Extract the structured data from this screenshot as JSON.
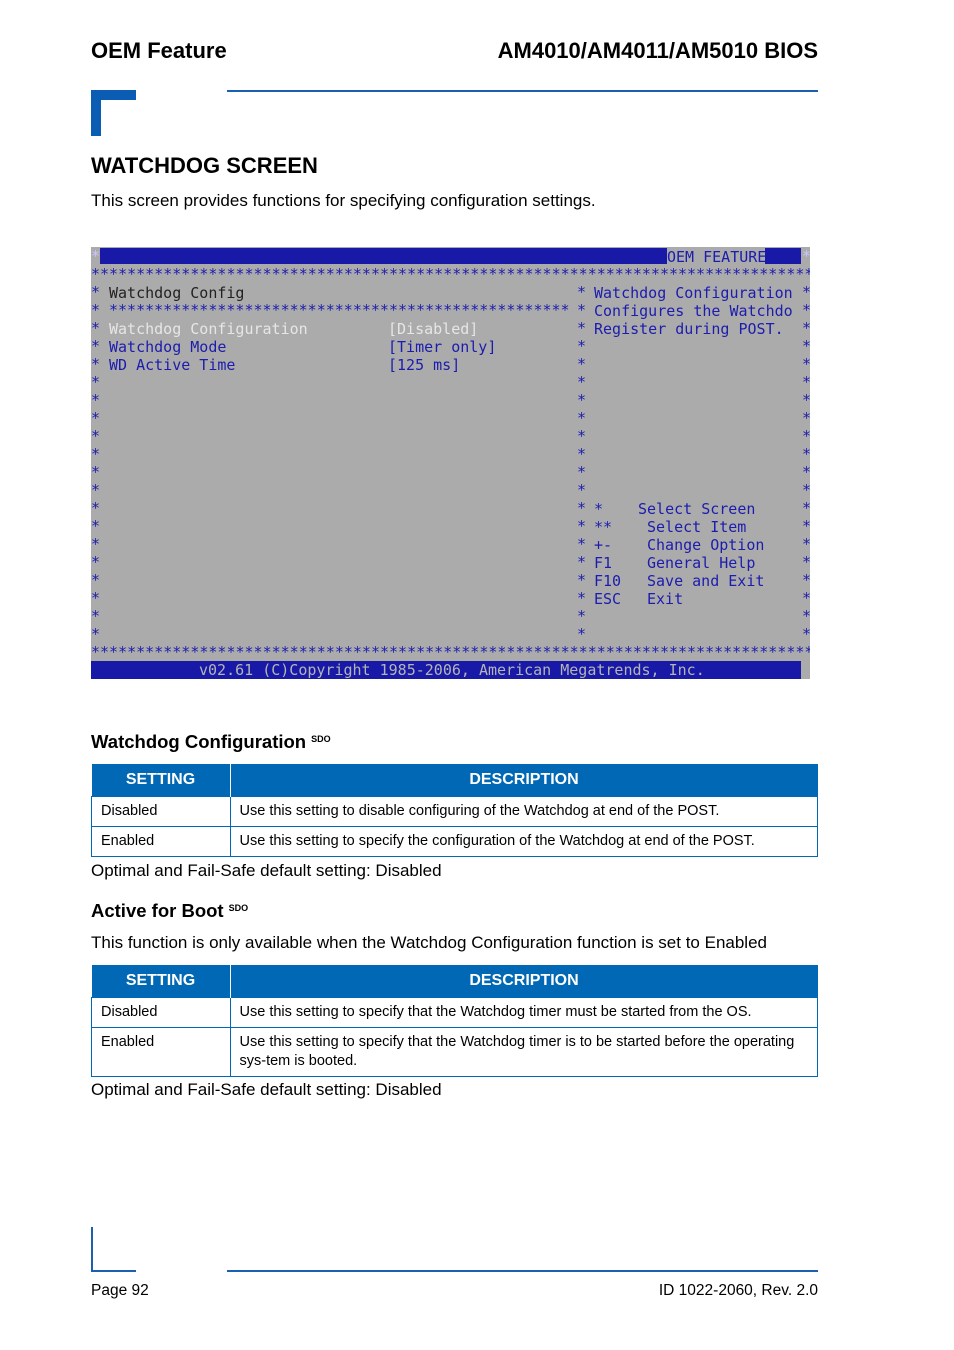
{
  "header": {
    "left": "OEM Feature",
    "right": "AM4010/AM4011/AM5010 BIOS"
  },
  "title": "WATCHDOG SCREEN",
  "intro": "This screen provides functions for specifying configuration settings.",
  "bios": {
    "border_char": "*",
    "header_label": "OEM FEATURE",
    "panel_title": "Watchdog Config",
    "items": [
      {
        "label": "Watchdog Configuration",
        "value": "[Disabled]",
        "selected": true
      },
      {
        "label": "Watchdog Mode",
        "value": "[Timer only]"
      },
      {
        "label": "WD Active Time",
        "value": "[125 ms]"
      }
    ],
    "help": [
      "Watchdog Configuration",
      "Configures the Watchdo",
      "Register during POST."
    ],
    "keys": [
      {
        "key": "*",
        "action": "Select Screen"
      },
      {
        "key": "**",
        "action": "Select Item"
      },
      {
        "key": "+-",
        "action": "Change Option"
      },
      {
        "key": "F1",
        "action": "General Help"
      },
      {
        "key": "F10",
        "action": "Save and Exit"
      },
      {
        "key": "ESC",
        "action": "Exit"
      }
    ],
    "footer": "v02.61 (C)Copyright 1985-2006, American Megatrends, Inc.",
    "colors": {
      "background": "#ababab",
      "bar": "#1919a8",
      "text": "#1c1cae"
    }
  },
  "sections": [
    {
      "title": "Watchdog Configuration",
      "sup": "SDO",
      "note": "",
      "columns": [
        "SETTING",
        "DESCRIPTION"
      ],
      "rows": [
        [
          "Disabled",
          "Use this setting to disable configuring of the Watchdog at end of the POST."
        ],
        [
          "Enabled",
          "Use this setting to specify the configuration of the Watchdog at end of the POST."
        ]
      ],
      "default": "Optimal and Fail-Safe default setting: Disabled"
    },
    {
      "title": "Active for Boot",
      "sup": "SDO",
      "note": "This function is only available when the Watchdog Configuration function is set to Enabled",
      "columns": [
        "SETTING",
        "DESCRIPTION"
      ],
      "rows": [
        [
          "Disabled",
          "Use this setting to specify that the Watchdog timer must be started from the OS."
        ],
        [
          "Enabled",
          "Use this setting to specify that the Watchdog timer is to be started before the operating sys-tem is booted."
        ]
      ],
      "default": "Optimal and Fail-Safe default setting: Disabled"
    }
  ],
  "footer": {
    "left": "Page 92",
    "right": "ID 1022-2060, Rev. 2.0"
  },
  "colors": {
    "accent": "#0068b4"
  }
}
